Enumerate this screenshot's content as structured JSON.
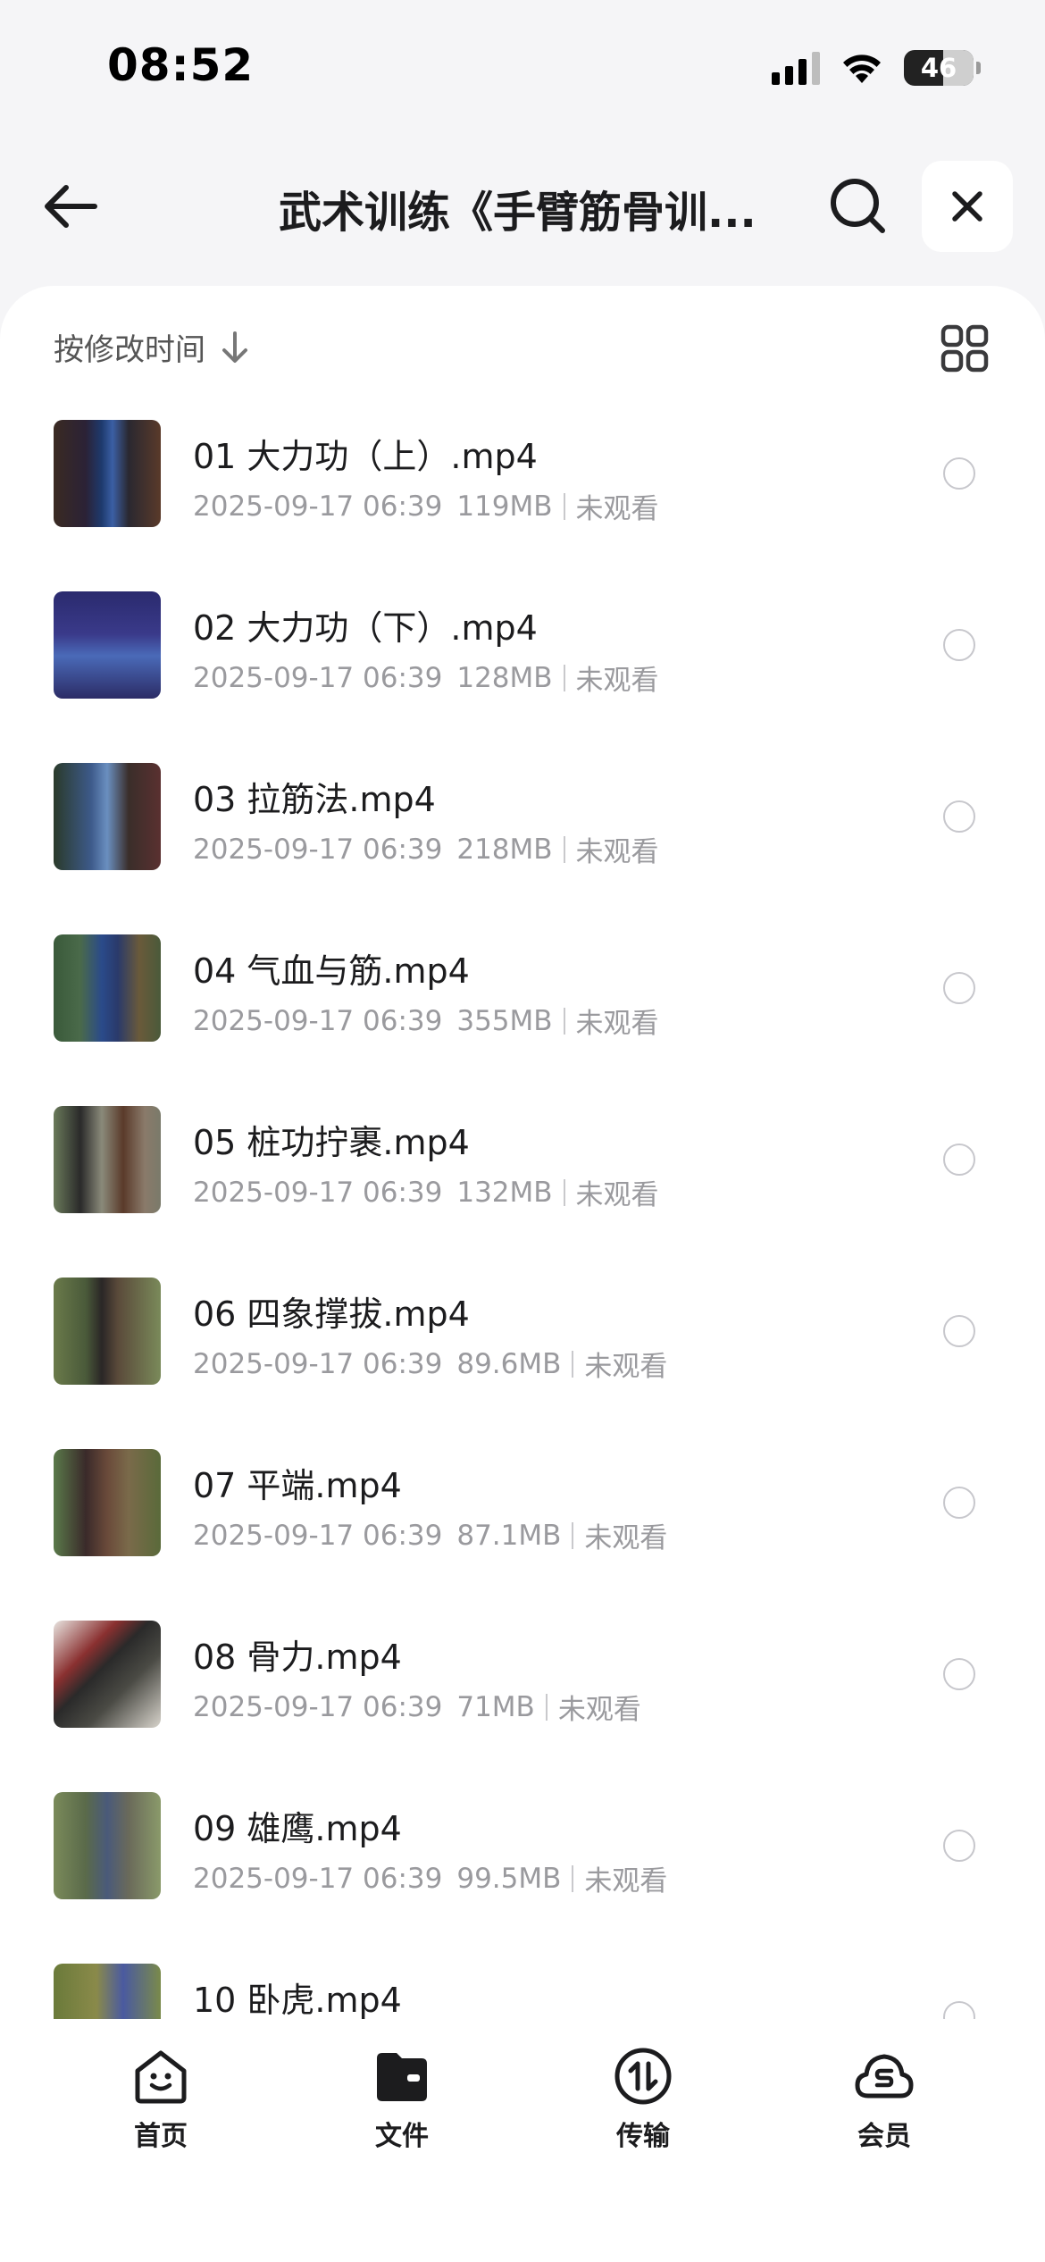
{
  "status_bar": {
    "time": "08:52",
    "battery": "46"
  },
  "header": {
    "title": "武术训练《手臂筋骨训..."
  },
  "sort": {
    "label": "按修改时间"
  },
  "files": [
    {
      "name": "01 大力功（上）.mp4",
      "date": "2025-09-17 06:39",
      "size": "119MB",
      "status": "未观看"
    },
    {
      "name": "02 大力功（下）.mp4",
      "date": "2025-09-17 06:39",
      "size": "128MB",
      "status": "未观看"
    },
    {
      "name": "03 拉筋法.mp4",
      "date": "2025-09-17 06:39",
      "size": "218MB",
      "status": "未观看"
    },
    {
      "name": "04 气血与筋.mp4",
      "date": "2025-09-17 06:39",
      "size": "355MB",
      "status": "未观看"
    },
    {
      "name": "05 桩功拧裹.mp4",
      "date": "2025-09-17 06:39",
      "size": "132MB",
      "status": "未观看"
    },
    {
      "name": "06 四象撑拔.mp4",
      "date": "2025-09-17 06:39",
      "size": "89.6MB",
      "status": "未观看"
    },
    {
      "name": "07 平端.mp4",
      "date": "2025-09-17 06:39",
      "size": "87.1MB",
      "status": "未观看"
    },
    {
      "name": "08 骨力.mp4",
      "date": "2025-09-17 06:39",
      "size": "71MB",
      "status": "未观看"
    },
    {
      "name": "09 雄鹰.mp4",
      "date": "2025-09-17 06:39",
      "size": "99.5MB",
      "status": "未观看"
    },
    {
      "name": "10 卧虎.mp4",
      "date": "",
      "size": "",
      "status": ""
    }
  ],
  "tabs": [
    {
      "label": "首页",
      "icon": "home-smile-icon"
    },
    {
      "label": "文件",
      "icon": "folder-icon"
    },
    {
      "label": "传输",
      "icon": "transfer-icon"
    },
    {
      "label": "会员",
      "icon": "vip-cloud-icon"
    }
  ],
  "colors": {
    "accent": "#1c1c1e",
    "muted": "#9a9a9e",
    "background": "#f5f5f7"
  }
}
